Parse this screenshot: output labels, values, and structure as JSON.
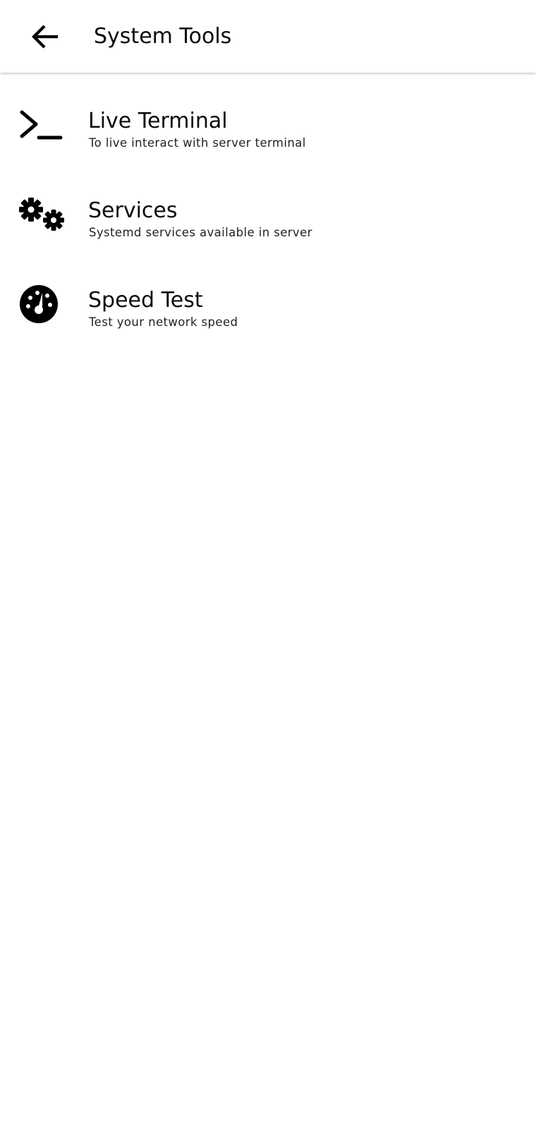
{
  "header": {
    "title": "System Tools",
    "back_icon": "arrow-back-icon"
  },
  "tools": [
    {
      "label": "Live Terminal",
      "description": "To live interact with server terminal",
      "icon": "terminal-icon"
    },
    {
      "label": "Services",
      "description": "Systemd services available in server",
      "icon": "gears-icon"
    },
    {
      "label": "Speed Test",
      "description": "Test your network speed",
      "icon": "speedometer-icon"
    }
  ],
  "colors": {
    "text": "#0b0b0b",
    "subtitle": "#222222",
    "background": "#ffffff"
  }
}
